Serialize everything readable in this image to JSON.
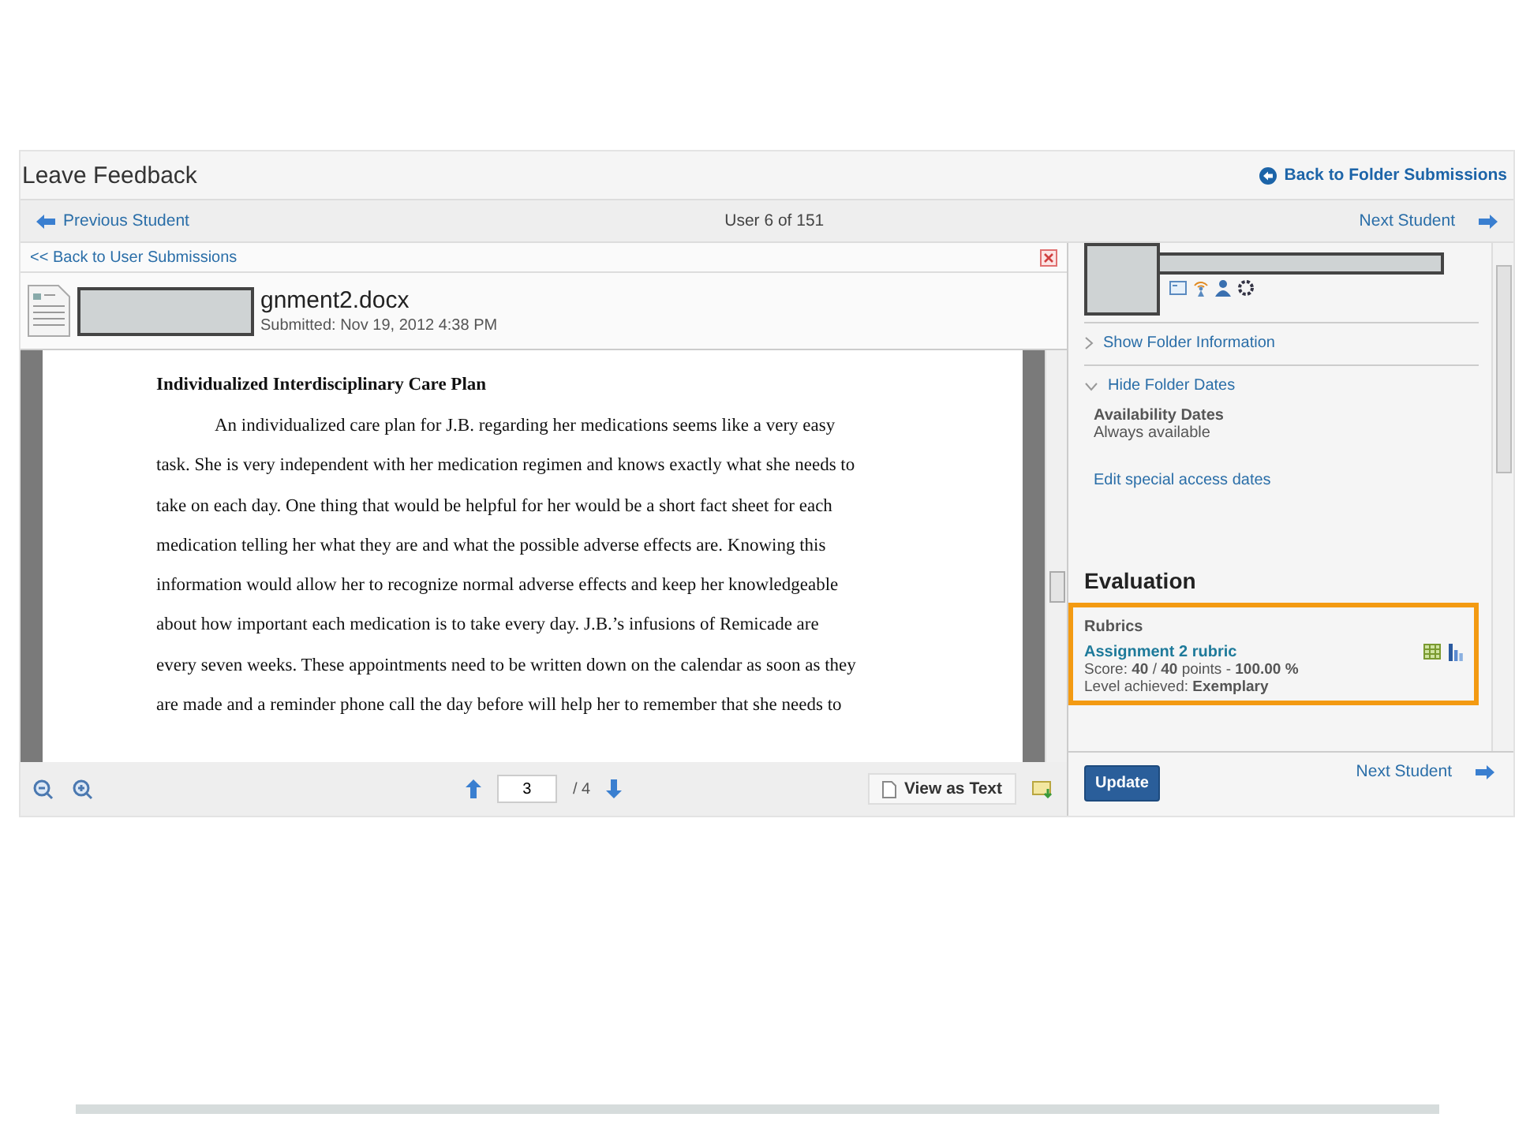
{
  "page_title": "Leave Feedback",
  "back_to_folder": "Back to Folder Submissions",
  "nav": {
    "previous": "Previous Student",
    "position": "User 6 of 151",
    "next": "Next Student"
  },
  "back_to_user": "<< Back to User Submissions",
  "file": {
    "name": "gnment2.docx",
    "submitted": "Submitted: Nov 19, 2012 4:38 PM"
  },
  "document": {
    "heading": "Individualized  Interdisciplinary Care Plan",
    "lines": [
      "An individualized  care plan for J.B. regarding her medications seems like a very easy",
      "task.   She is very independent with her medication regimen and knows exactly what she needs to",
      "take on each day.  One thing that would be helpful for her would be a short fact sheet for each",
      "medication telling her what they are and what the possible adverse effects are.  Knowing this",
      "information would allow her to recognize normal adverse effects and keep her knowledgeable",
      "about how important each medication is to take every day.  J.B.’s infusions of Remicade are",
      "every seven weeks.  These appointments need to be written down on the calendar as soon as they",
      "are made and a reminder phone call the day before will help her to remember that she needs to"
    ]
  },
  "pager": {
    "page": "3",
    "total": "/ 4",
    "view_as_text": "View as Text"
  },
  "sidebar": {
    "show_folder_info": "Show Folder Information",
    "hide_folder_dates": "Hide Folder Dates",
    "availability_label": "Availability Dates",
    "availability_value": "Always available",
    "edit_dates": "Edit special access dates",
    "evaluation": "Evaluation",
    "rubrics": "Rubrics",
    "rubric_name": "Assignment 2 rubric",
    "score": "Score: **40** / **40** points - **100.00 %**",
    "level": "Level achieved: **Exemplary**",
    "update": "Update",
    "next": "Next Student"
  }
}
